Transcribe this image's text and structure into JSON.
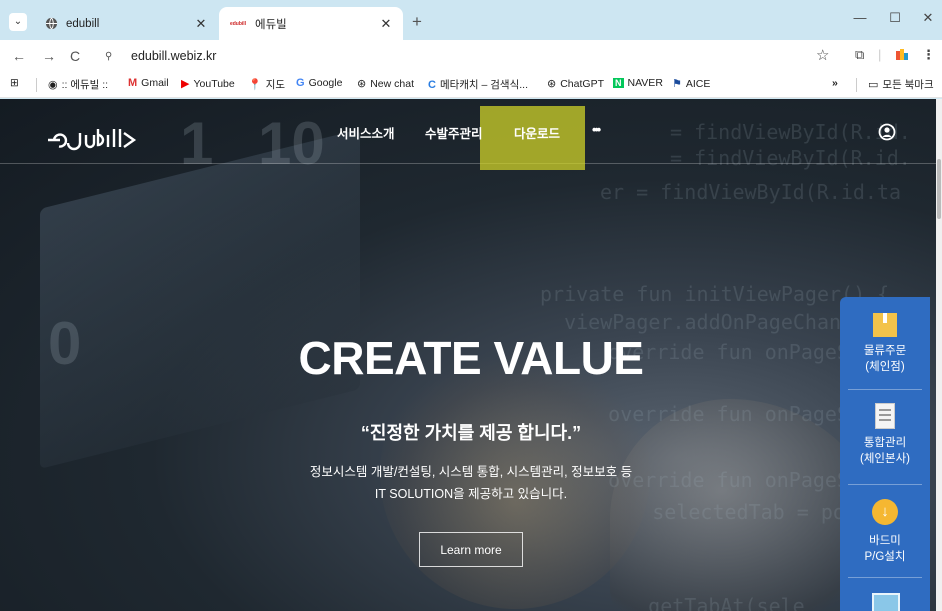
{
  "browser": {
    "tabs": [
      {
        "title": "edubill",
        "active": false
      },
      {
        "title": "에듀빌",
        "active": true
      }
    ],
    "favicon_text": "edubill",
    "url": "edubill.webiz.kr",
    "bookmarks": [
      {
        "label": ":: 에듀빌 ::",
        "icon": "globe-icon"
      },
      {
        "label": "Gmail",
        "icon": "gmail-icon"
      },
      {
        "label": "YouTube",
        "icon": "youtube-icon"
      },
      {
        "label": "지도",
        "icon": "maps-icon"
      },
      {
        "label": "Google",
        "icon": "google-icon"
      },
      {
        "label": "New chat",
        "icon": "chatgpt-icon"
      },
      {
        "label": "메타캐치 – 검색식...",
        "icon": "metacatch-icon"
      },
      {
        "label": "ChatGPT",
        "icon": "chatgpt-icon"
      },
      {
        "label": "NAVER",
        "icon": "naver-icon"
      },
      {
        "label": "AICE",
        "icon": "aice-icon"
      }
    ],
    "more_bookmarks": "»",
    "all_bookmarks": "모든 북마크"
  },
  "site": {
    "logo_text": "edubill",
    "menu": [
      "서비스소개",
      "수발주관리",
      "다운로드",
      "•••"
    ],
    "highlight_color": "#d6d828",
    "hero": {
      "title": "CREATE VALUE",
      "subtitle": "“진정한 가치를 제공 합니다.”",
      "desc_line1": "정보시스템 개발/컨설팅, 시스템 통합, 시스템관리, 정보보호 등",
      "desc_line2": "IT SOLUTION을 제공하고 있습니다.",
      "button": "Learn more"
    },
    "quick_menu": [
      {
        "line1": "물류주문",
        "line2": "(체인점)",
        "icon": "box-icon"
      },
      {
        "line1": "통합관리",
        "line2": "(체인본사)",
        "icon": "document-icon"
      },
      {
        "line1": "바드미",
        "line2": "P/G설치",
        "icon": "download-icon"
      }
    ],
    "quick_color": "#2f6cc1",
    "background_digits": [
      "1",
      "10",
      "0"
    ],
    "background_code": [
      "= findViewById(R.id.",
      "= findViewById(R.id.",
      "er = findViewById(R.id.ta",
      "private fun initViewPager() {",
      "  viewPager.addOnPageChan",
      "    override fun onPageS",
      "    override fun onPageS",
      "    override fun onPageS",
      "      selectedTab = po",
      "    getTabAt(sele"
    ]
  }
}
